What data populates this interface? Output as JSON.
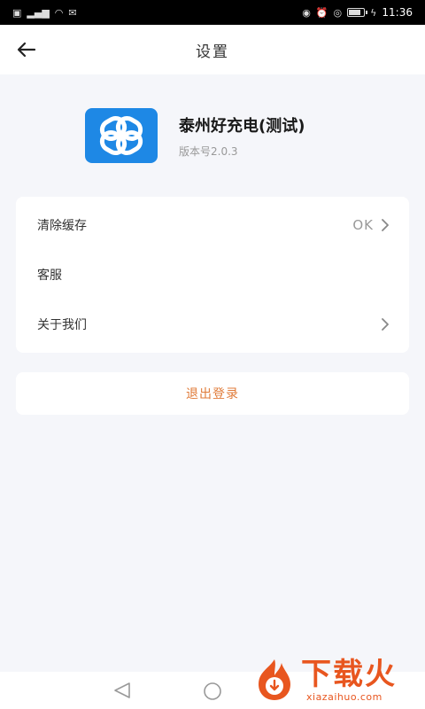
{
  "status_bar": {
    "left_glyphs": [
      "HD",
      "4G",
      "wifi",
      "sig"
    ],
    "right_glyphs": [
      "eye",
      "alarm",
      "loc",
      "batt"
    ],
    "time": "11:36"
  },
  "header": {
    "title": "设置",
    "back_icon": "arrow-left-icon"
  },
  "app": {
    "name": "泰州好充电(测试)",
    "version": "版本号2.0.3",
    "icon_color": "#1e88e5"
  },
  "settings": {
    "items": [
      {
        "label": "清除缓存",
        "value": "OK",
        "has_chevron": true
      },
      {
        "label": "客服",
        "value": "",
        "has_chevron": false
      },
      {
        "label": "关于我们",
        "value": "",
        "has_chevron": true
      }
    ]
  },
  "logout": {
    "label": "退出登录",
    "color": "#e07b39"
  },
  "watermark": {
    "text": "下载火",
    "url": "xiazaihuo.com",
    "color": "#e8561f"
  },
  "colors": {
    "background": "#f5f6fa",
    "card": "#ffffff",
    "accent": "#1e88e5"
  }
}
